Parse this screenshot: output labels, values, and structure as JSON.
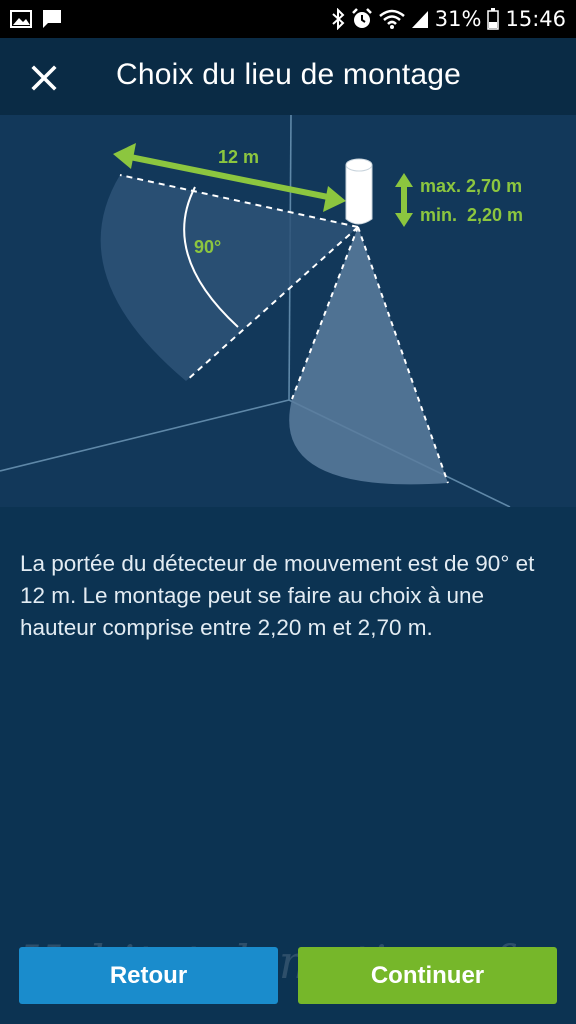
{
  "status_bar": {
    "battery": "31%",
    "time": "15:46",
    "icons": [
      "gallery-icon",
      "message-icon",
      "bluetooth-icon",
      "alarm-icon",
      "wifi-icon",
      "signal-icon",
      "battery-icon"
    ]
  },
  "app_bar": {
    "title": "Choix du lieu de montage",
    "close_icon": "close-icon"
  },
  "illustration": {
    "range_label": "12 m",
    "angle_label": "90°",
    "height_max": "max. 2,70 m",
    "height_min": "min.  2,20 m",
    "accent_color": "#8cc63f"
  },
  "description": "La portée du détecteur de mouvement est de 90° et 12 m. Le montage peut se faire au choix à une hauteur comprise entre 2,20 m et 2,70 m.",
  "buttons": {
    "back": "Retour",
    "next": "Continuer"
  },
  "watermark": "Habitat-domotique.fr",
  "colors": {
    "background": "#0c3352",
    "back_button": "#1a8ccc",
    "next_button": "#76b72a"
  }
}
